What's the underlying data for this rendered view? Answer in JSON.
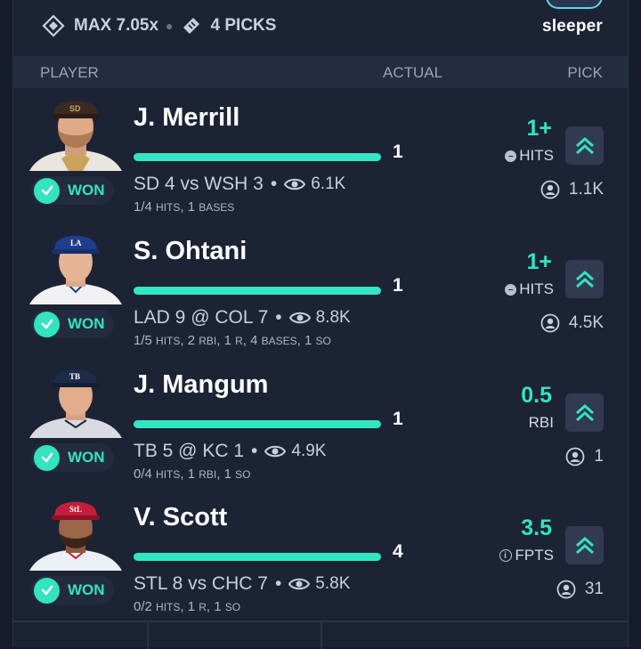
{
  "topbar": {
    "max_label": "MAX 7.05x",
    "picks_label": "4 PICKS",
    "brand": "sleeper"
  },
  "header": {
    "player": "PLAYER",
    "actual": "ACTUAL",
    "pick": "PICK"
  },
  "colors": {
    "accent": "#34e3c0",
    "background": "#1c2335",
    "cap_padres": "#3b2a22",
    "cap_dodgers": "#1f3d8a",
    "cap_rays": "#1d2a48",
    "cap_cardinals": "#c41e3a"
  },
  "rows": [
    {
      "name": "J. Merrill",
      "status": "WON",
      "actual": "1",
      "game": "SD 4 vs WSH 3",
      "views": "6.1K",
      "stats_html": "1/4 hits, 1 bases",
      "stats": "1/4 HITS, 1 BASES",
      "pick_value": "1+",
      "pick_stat": "HITS",
      "pick_count": "1.1K",
      "cap": "padres-cap-icon"
    },
    {
      "name": "S. Ohtani",
      "status": "WON",
      "actual": "1",
      "game": "LAD 9 @ COL 7",
      "views": "8.8K",
      "stats": "1/5 HITS, 2 RBI, 1 R, 4 BASES, 1 SO",
      "pick_value": "1+",
      "pick_stat": "HITS",
      "pick_count": "4.5K",
      "cap": "dodgers-cap-icon"
    },
    {
      "name": "J. Mangum",
      "status": "WON",
      "actual": "1",
      "game": "TB 5 @ KC 1",
      "views": "4.9K",
      "stats": "0/4 HITS, 1 RBI, 1 SO",
      "pick_value": "0.5",
      "pick_stat": "RBI",
      "pick_count": "1",
      "cap": "rays-cap-icon"
    },
    {
      "name": "V. Scott",
      "status": "WON",
      "actual": "4",
      "game": "STL 8 vs CHC 7",
      "views": "5.8K",
      "stats": "0/2 HITS, 1 R, 1 SO",
      "pick_value": "3.5",
      "pick_stat": "FPTS",
      "pick_count": "31",
      "cap": "cardinals-cap-icon"
    }
  ]
}
